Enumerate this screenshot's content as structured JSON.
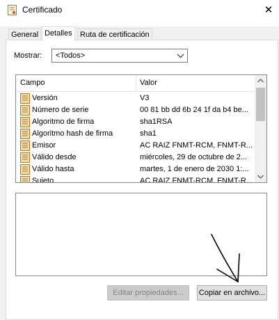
{
  "window": {
    "title": "Certificado",
    "close_glyph": "✕",
    "icon": "certificate-icon"
  },
  "tabs": [
    {
      "label": "General",
      "active": false
    },
    {
      "label": "Detalles",
      "active": true
    },
    {
      "label": "Ruta de certificación",
      "active": false
    }
  ],
  "filter": {
    "label": "Mostrar:",
    "value": "<Todos>"
  },
  "list": {
    "columns": [
      "Campo",
      "Valor"
    ],
    "rows": [
      {
        "field": "Versión",
        "value": "V3"
      },
      {
        "field": "Número de serie",
        "value": "00 81 bb dd 6b 24 1f da b4 be..."
      },
      {
        "field": "Algoritmo de firma",
        "value": "sha1RSA"
      },
      {
        "field": "Algoritmo hash de firma",
        "value": "sha1"
      },
      {
        "field": "Emisor",
        "value": "AC RAIZ FNMT-RCM, FNMT-R..."
      },
      {
        "field": "Válido desde",
        "value": "miércoles, 29 de octubre de 2..."
      },
      {
        "field": "Válido hasta",
        "value": "martes, 1 de enero de 2030 1:..."
      },
      {
        "field": "Sujeto",
        "value": "AC RAIZ FNMT-RCM, FNMT-R..."
      }
    ]
  },
  "buttons": {
    "edit": "Editar propiedades...",
    "copy": "Copiar en archivo..."
  },
  "colors": {
    "window_bg": "#ffffff",
    "panel_bg": "#f0f0f0",
    "border": "#828790",
    "icon_fill": "#f3d9a4",
    "icon_stroke": "#a77a2e"
  }
}
